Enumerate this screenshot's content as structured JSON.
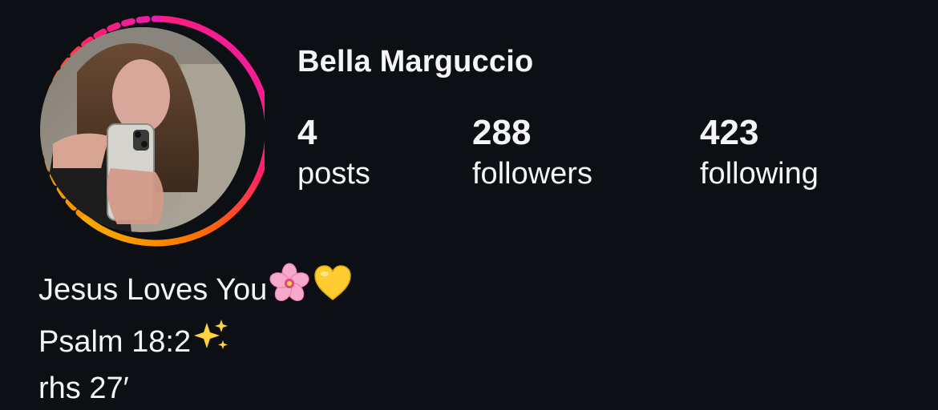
{
  "profile": {
    "name": "Bella Marguccio",
    "has_story_ring": true,
    "story_ring_colors": [
      "#f8b400",
      "#ff6a00",
      "#ff1f6b",
      "#e91bb8"
    ]
  },
  "stats": {
    "posts": {
      "count": "4",
      "label": "posts"
    },
    "followers": {
      "count": "288",
      "label": "followers"
    },
    "following": {
      "count": "423",
      "label": "following"
    }
  },
  "bio": {
    "line1": "Jesus Loves You",
    "line1_emojis": [
      "cherry-blossom-icon",
      "yellow-heart-icon"
    ],
    "line2": "Psalm 18:2",
    "line2_emojis": [
      "sparkles-icon"
    ],
    "line3": "rhs 27′"
  }
}
